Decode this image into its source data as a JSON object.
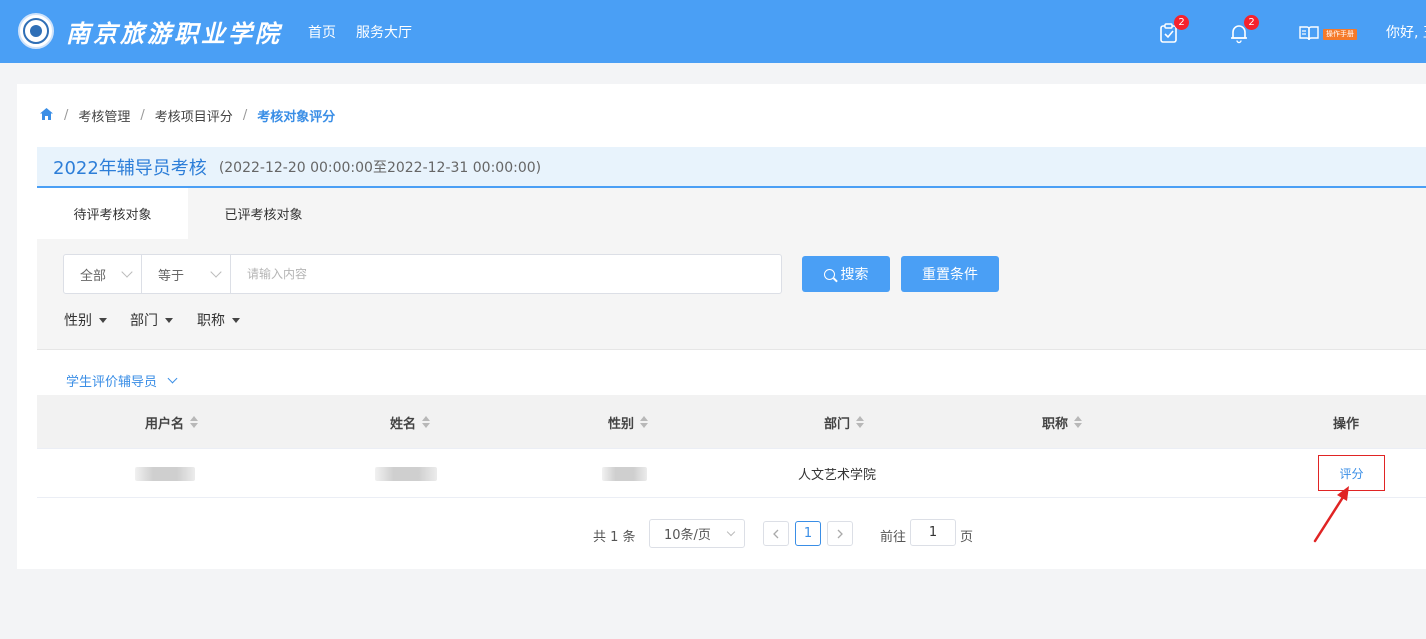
{
  "header": {
    "school_name": "南京旅游职业学院",
    "nav": [
      "首页",
      "服务大厅"
    ],
    "todo_badge": "2",
    "notice_badge": "2",
    "manual_label": "操作手册",
    "greeting": "你好, 王"
  },
  "breadcrumb": [
    "考核管理",
    "考核项目评分",
    "考核对象评分"
  ],
  "exam": {
    "title": "2022年辅导员考核",
    "range": "(2022-12-20 00:00:00至2022-12-31 00:00:00)"
  },
  "tabs": [
    "待评考核对象",
    "已评考核对象"
  ],
  "filters": {
    "field": "全部",
    "operator": "等于",
    "search_placeholder": "请输入内容",
    "search_value": "",
    "search_button": "搜索",
    "reset_button": "重置条件",
    "dropdowns": [
      "性别",
      "部门",
      "职称"
    ]
  },
  "group_select": "学生评价辅导员",
  "table": {
    "columns": [
      "用户名",
      "姓名",
      "性别",
      "部门",
      "职称",
      "操作"
    ],
    "rows": [
      {
        "username": "",
        "name": "",
        "gender": "",
        "department": "人文艺术学院",
        "title": "",
        "action": "评分"
      }
    ]
  },
  "pagination": {
    "total": "共 1 条",
    "page_size": "10条/页",
    "current_page": "1",
    "goto_label": "前往",
    "goto_value": "1",
    "page_unit": "页"
  },
  "colors": {
    "header_bg": "#4a9ff5",
    "accent": "#3a8ee6",
    "highlight_border": "#e02424"
  }
}
